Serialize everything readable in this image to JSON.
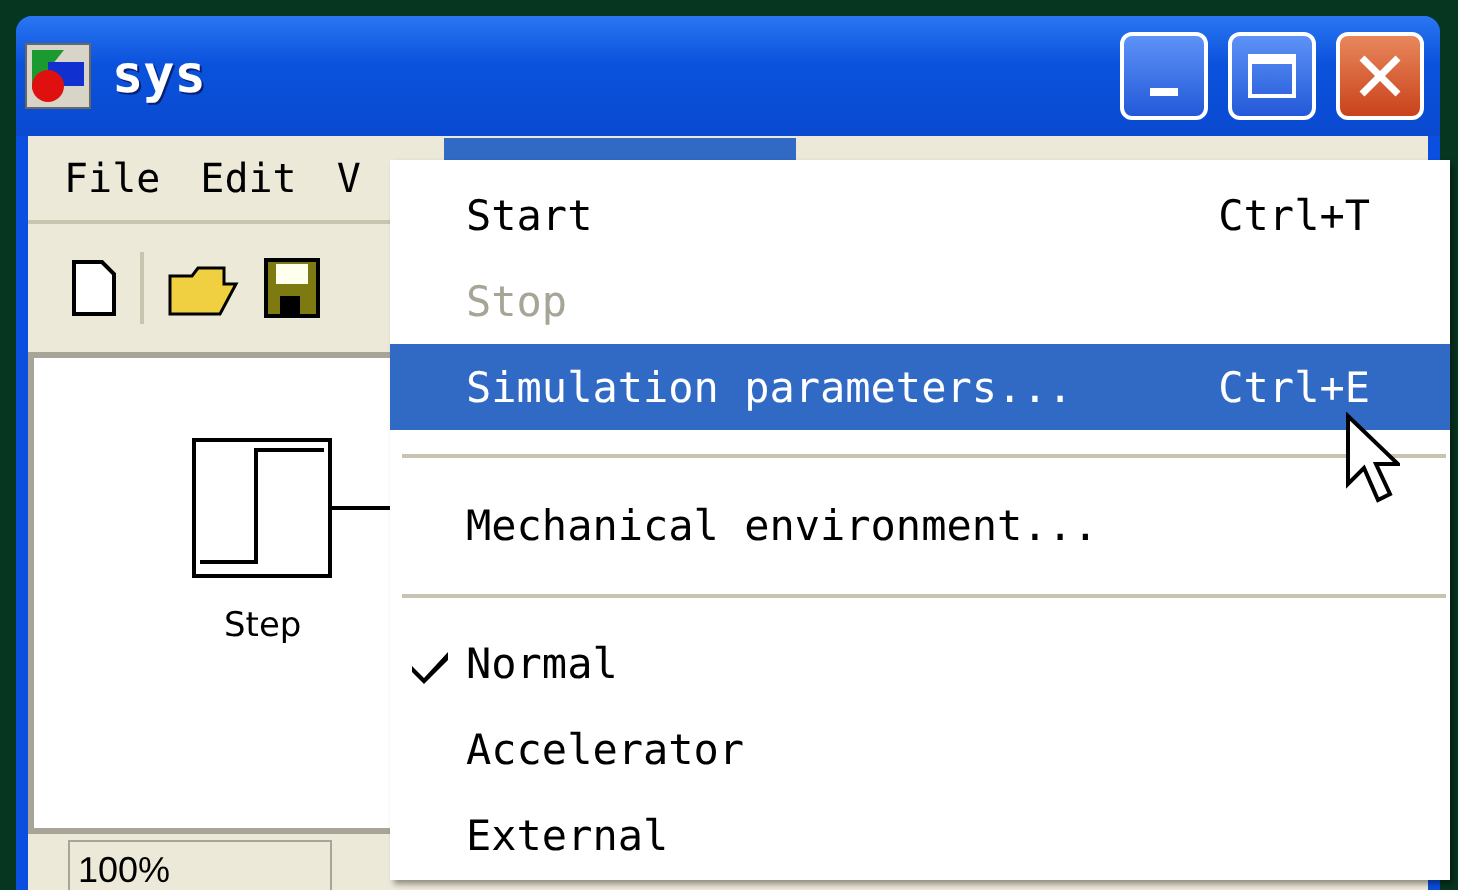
{
  "window": {
    "title": "sys"
  },
  "menu_bar": [
    {
      "label": "File",
      "selected": false
    },
    {
      "label": "Edit",
      "selected": false
    },
    {
      "label": "V",
      "selected": false
    },
    {
      "selected": true
    }
  ],
  "canvas": {
    "blocks": [
      {
        "label": "Step"
      }
    ]
  },
  "status_bar": {
    "zoom": "100%"
  },
  "dropdown": {
    "items": [
      {
        "kind": "item",
        "label": "Start",
        "shortcut": "Ctrl+T",
        "disabled": false,
        "highlighted": false
      },
      {
        "kind": "item",
        "label": "Stop",
        "disabled": true,
        "highlighted": false
      },
      {
        "kind": "item",
        "label": "Simulation parameters...",
        "shortcut": "Ctrl+E",
        "disabled": false,
        "highlighted": true
      },
      {
        "kind": "separator"
      },
      {
        "kind": "item",
        "label": "Mechanical environment...",
        "disabled": false,
        "highlighted": false
      },
      {
        "kind": "separator"
      },
      {
        "kind": "check",
        "label": "Normal",
        "checked": true
      },
      {
        "kind": "check",
        "label": "Accelerator",
        "checked": false
      },
      {
        "kind": "check",
        "label": "External",
        "checked": false
      }
    ]
  }
}
